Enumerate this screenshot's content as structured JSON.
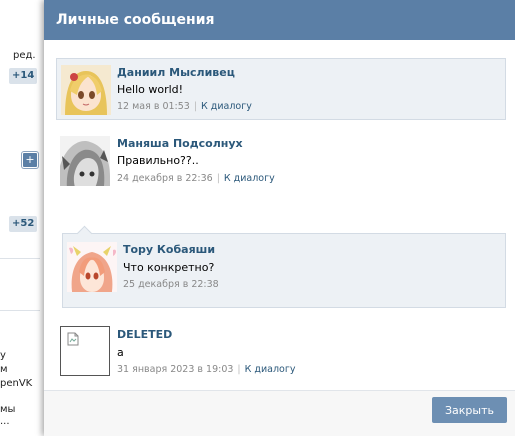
{
  "background": {
    "edit_label": "ред.",
    "badge_top": "+14",
    "plus_button": "+",
    "badge_mid": "+52",
    "text_lines": [
      "у",
      "м",
      "penVK",
      "мы",
      "..."
    ]
  },
  "dialog": {
    "title": "Личные сообщения",
    "close_button": "Закрыть",
    "messages": [
      {
        "author": "Даниил Мысливец",
        "text": "Hello world!",
        "date": "12 мая в 01:53",
        "link": "К диалогу"
      },
      {
        "author": "Маняша Подсолнух",
        "text": "Правильно??..",
        "date": "24 декабря в 22:36",
        "link": "К диалогу"
      },
      {
        "author": "Тору Кобаяши",
        "text": "Что конкретно?",
        "date": "25 декабря в 22:38"
      },
      {
        "author": "DELETED",
        "text": "а",
        "date": "31 января 2023 в 19:03",
        "link": "К диалогу"
      }
    ]
  },
  "colors": {
    "header": "#5b7fa6",
    "author_link": "#2b587a",
    "highlight_bg": "#edf1f5",
    "button": "#6d8fb3"
  }
}
